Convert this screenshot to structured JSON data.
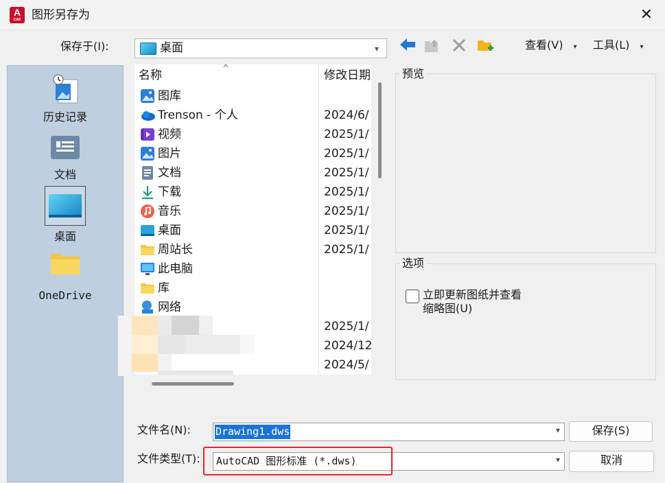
{
  "window": {
    "title": "图形另存为",
    "app_icon_text": "A",
    "app_icon_sub": "CAD"
  },
  "save_in": {
    "label": "保存于(I):",
    "value": "桌面"
  },
  "toolbar": {
    "view_label": "查看(V)",
    "tools_label": "工具(L)"
  },
  "places": [
    {
      "label": "历史记录",
      "icon": "history-icon"
    },
    {
      "label": "文档",
      "icon": "documents-icon"
    },
    {
      "label": "桌面",
      "icon": "desktop-icon",
      "selected": true
    },
    {
      "label": "OneDrive",
      "icon": "folder-icon"
    }
  ],
  "file_list": {
    "columns": [
      "名称",
      "修改日期"
    ],
    "items": [
      {
        "name": "图库",
        "date": "",
        "icon": "gallery-icon"
      },
      {
        "name": "Trenson - 个人",
        "date": "2024/6/",
        "icon": "onedrive-cloud-icon"
      },
      {
        "name": "视频",
        "date": "2025/1/",
        "icon": "video-icon"
      },
      {
        "name": "图片",
        "date": "2025/1/",
        "icon": "pictures-icon"
      },
      {
        "name": "文档",
        "date": "2025/1/",
        "icon": "documents-icon"
      },
      {
        "name": "下载",
        "date": "2025/1/",
        "icon": "download-icon"
      },
      {
        "name": "音乐",
        "date": "2025/1/",
        "icon": "music-icon"
      },
      {
        "name": "桌面",
        "date": "2025/1/",
        "icon": "desktop-icon"
      },
      {
        "name": "周站长",
        "date": "2025/1/",
        "icon": "folder-icon"
      },
      {
        "name": "此电脑",
        "date": "",
        "icon": "computer-icon"
      },
      {
        "name": "库",
        "date": "",
        "icon": "folder-icon"
      },
      {
        "name": "网络",
        "date": "",
        "icon": "network-icon"
      },
      {
        "name": "",
        "date": "2025/1/",
        "icon": ""
      },
      {
        "name": "",
        "date": "2024/12",
        "icon": ""
      },
      {
        "name": "",
        "date": "2024/5/",
        "icon": ""
      }
    ]
  },
  "preview": {
    "title": "预览"
  },
  "options": {
    "title": "选项",
    "checkbox_line1": "立即更新图纸并查看",
    "checkbox_line2": "缩略图(U)",
    "checked": false
  },
  "filename": {
    "label": "文件名(N):",
    "value": "Drawing1.dws"
  },
  "filetype": {
    "label": "文件类型(T):",
    "value": "AutoCAD 图形标准 (*.dws)"
  },
  "buttons": {
    "save": "保存(S)",
    "cancel": "取消"
  },
  "colors": {
    "highlight": "#e0262b",
    "selection": "#1a73d6",
    "places_bg": "#bfcfdf"
  }
}
